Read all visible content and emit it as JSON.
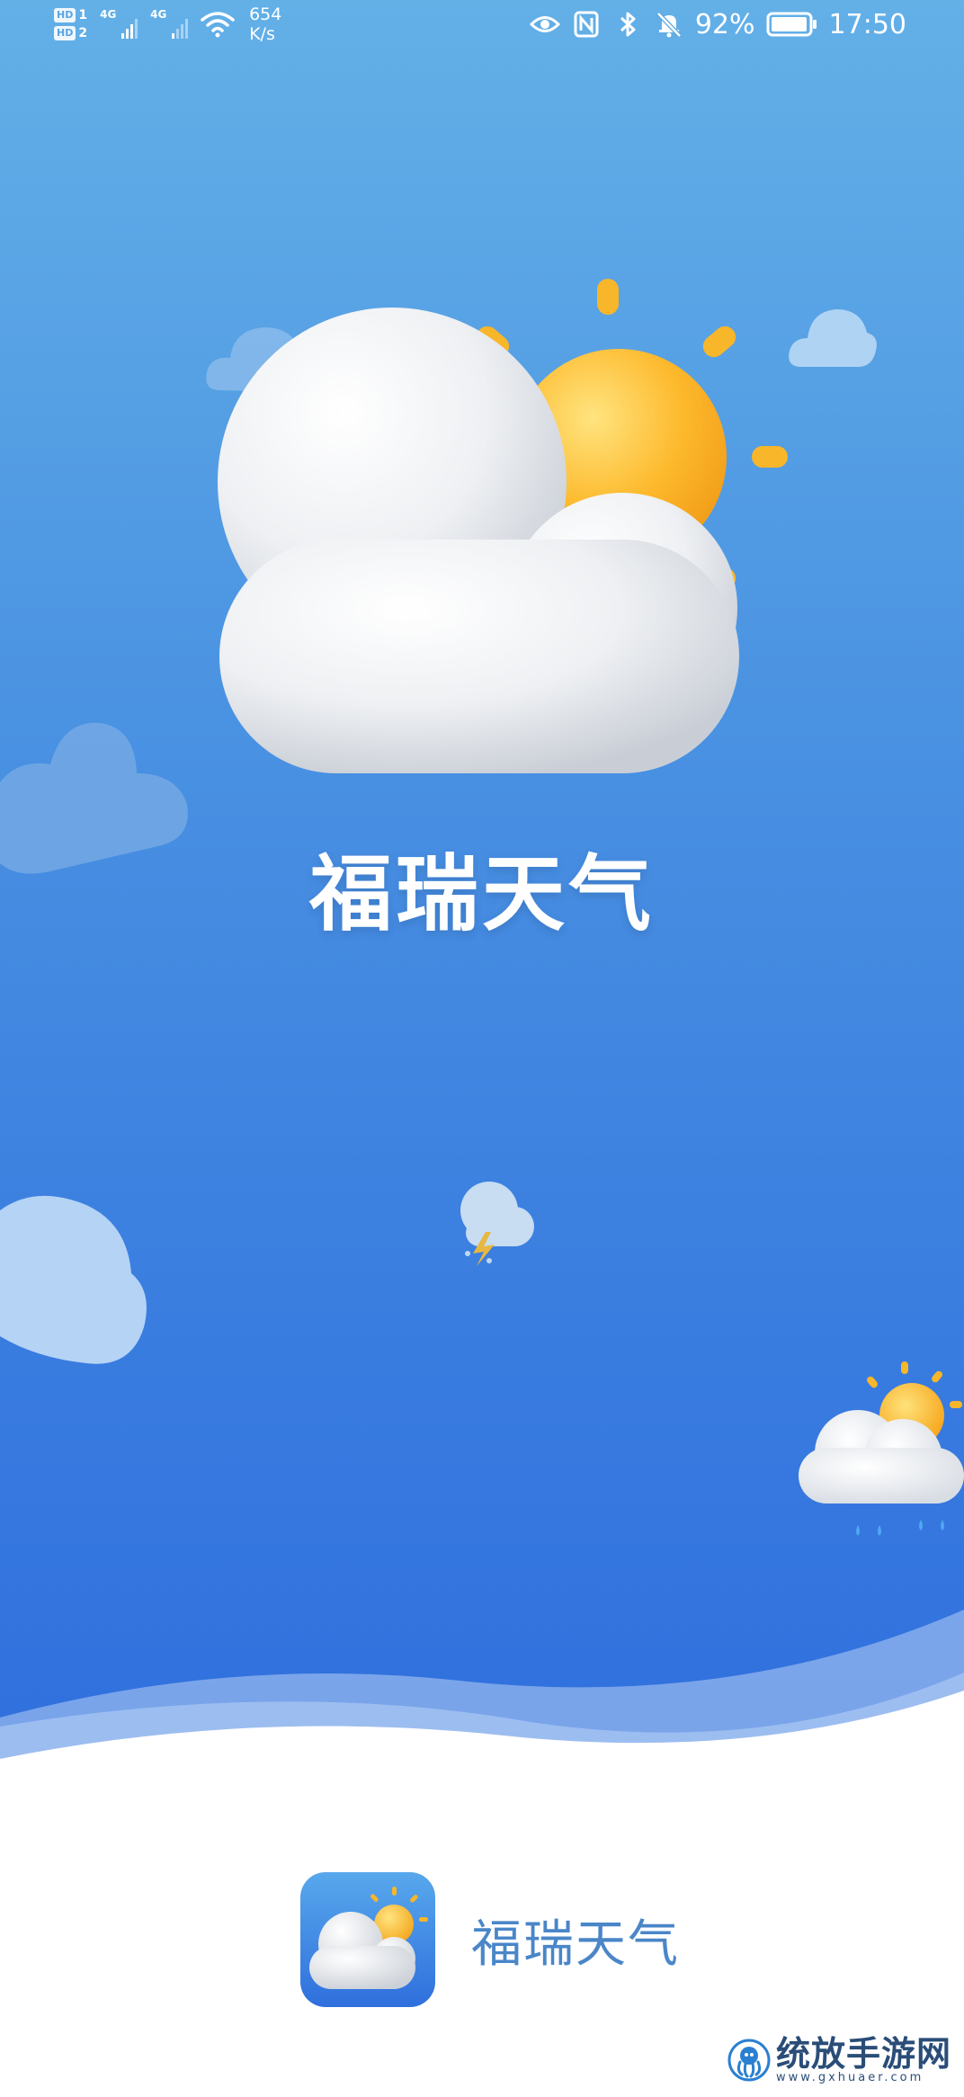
{
  "status_bar": {
    "sim1": "1",
    "sim2": "2",
    "hd_label": "HD",
    "network1": "4G",
    "network2": "4G",
    "speed_value": "654",
    "speed_unit": "K/s",
    "battery": "92%",
    "time": "17:50"
  },
  "splash": {
    "title": "福瑞天气"
  },
  "brand": {
    "name": "福瑞天气"
  },
  "watermark": {
    "title": "统放手游网",
    "url": "www.gxhuaer.com"
  },
  "icons": [
    "hd-icon",
    "signal-icon",
    "wifi-icon",
    "eye-icon",
    "nfc-icon",
    "bluetooth-icon",
    "bell-muted-icon",
    "battery-icon",
    "partly-cloudy-icon",
    "cloud-icon",
    "thunder-cloud-icon",
    "rain-sun-cloud-icon"
  ],
  "colors": {
    "sky_top": "#63b0e7",
    "sky_bottom": "#2f6ede",
    "sun": "#fbb72b",
    "brand_text": "#4a86c8"
  }
}
